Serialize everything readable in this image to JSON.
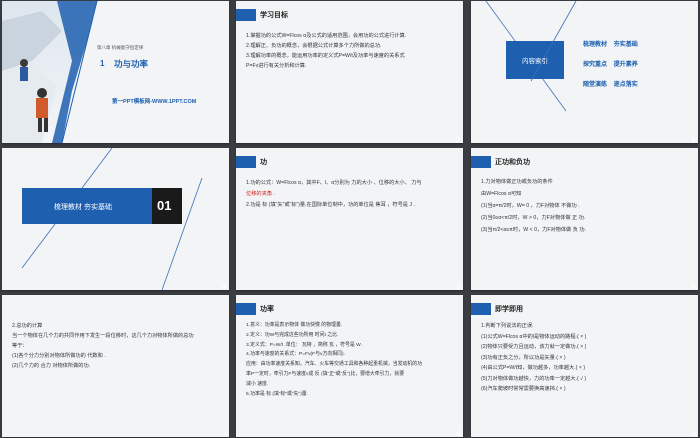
{
  "slides": [
    {
      "num": "1",
      "chapter": "第八章  机械能守恒定律",
      "lesson_no": "1",
      "lesson_title": "功与功率",
      "site": "第一PPT模板网-WWW.1PPT.COM"
    },
    {
      "num": "2",
      "header": "学习目标",
      "lines": [
        "1.掌握功的公式W=Flcos α及公式的适用范围，会用功的公式进行计算.",
        "2.理解正、负功的概念，会根据公式计算多个力所做的总功.",
        "3.理解功率的概念，能运用功率的定义式P=W/t及功率与速度的关系式",
        "P=Fv进行有关分析和计算."
      ]
    },
    {
      "num": "3",
      "box_title": "内容索引",
      "items": [
        {
          "a": "梳理教材",
          "b": "夯实基础"
        },
        {
          "a": "探究重点",
          "b": "提升素养"
        },
        {
          "a": "随堂演练",
          "b": "逐点落实"
        }
      ]
    },
    {
      "num": "4",
      "banner": "梳理教材  夯实基础",
      "index": "01"
    },
    {
      "num": "5",
      "header": "功",
      "lines": [
        "1.功的公式：W=Flcos α，其中F、l、α分别为 力的大小 、位移的大小、 力与",
        "   位移的夹角 .",
        "2.功是 标 (填“矢”或“标”)量.在国际单位制中，功的单位是 焦耳 ，符号是 J ."
      ]
    },
    {
      "num": "6",
      "header": "正功和负功",
      "lines": [
        "1.力对物体做正功或负功的条件",
        "由W=Flcos α可知",
        "(1)当α=π/2时，W= 0 ，力F对物体 不做功 .",
        "(2)当0≤α<π/2时，W > 0，力F对物体做 正 功.",
        "(3)当π/2<α≤π时，W < 0，力F对物体做 负 功."
      ]
    },
    {
      "num": "7",
      "lines": [
        "2.总功的计算",
        "当一个物体在几个力的共同作用下发生一段位移时，这几个力对物体所做的总功",
        "等于：",
        "(1)各个分力分别对物体所做功的 代数和 .",
        "(2)几个力的 合力 对物体所做的功."
      ]
    },
    {
      "num": "8",
      "header": "功率",
      "lines": [
        "1.意义：功率是表示物体 做功快慢 的物理量.",
        "2.定义：功W与完成这些功所用 时间t 之比.",
        "3.定义式：P=W/t .单位： 瓦特 ，简称 瓦 ，符号是 W .",
        "4.功率与速度的关系式：P=Fv(F与v方向相同).",
        "应用：由功率速度关系知，汽车、火车等交通工具和各种起重机械，当发动机的功",
        "率P一定时，牵引力F与速度v成 反 (填“正”或“反”)比，要增大牵引力，就要",
        " 减小 速度.",
        "5.功率是 标 (填“标”或“矢”)量."
      ]
    },
    {
      "num": "9",
      "header": "即学即用",
      "lines": [
        "1.判断下列说法的正误.",
        "(1)公式W=Flcos α中的l是物体运动的路程.( × )",
        "(2)物体只要受力且运动，该力就一定做功.( × )",
        "(3)功有正负之分，所以功是矢量.( × )",
        "(4)由公式P=W/t知，做功越多，功率越大.( × )",
        "(5)力对物体做功越快，力的功率一定越大.( √ )",
        "(6)汽车爬坡时常常需要换高速挡.( × )"
      ]
    }
  ]
}
